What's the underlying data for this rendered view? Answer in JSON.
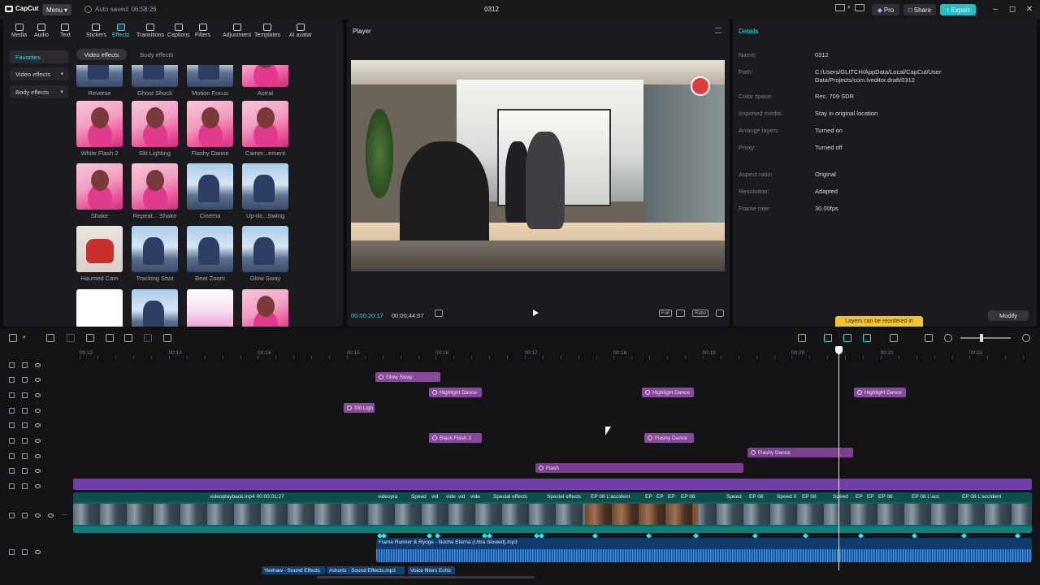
{
  "app": {
    "brand": "CapCut",
    "menu_label": "Menu",
    "autosave": "Auto saved: 06:58:26",
    "project_title": "0312",
    "pro_label": "Pro",
    "share_label": "Share",
    "export_label": "Export",
    "accent_color": "#1fc0c7"
  },
  "toolbar": [
    {
      "label": "Media",
      "icon": "media-icon"
    },
    {
      "label": "Audio",
      "icon": "audio-icon"
    },
    {
      "label": "Text",
      "icon": "text-icon"
    },
    {
      "label": "Stickers",
      "icon": "stickers-icon"
    },
    {
      "label": "Effects",
      "icon": "effects-icon",
      "active": true
    },
    {
      "label": "Transitions",
      "icon": "transitions-icon"
    },
    {
      "label": "Captions",
      "icon": "captions-icon"
    },
    {
      "label": "Filters",
      "icon": "filters-icon"
    },
    {
      "label": "Adjustment",
      "icon": "adjustment-icon"
    },
    {
      "label": "Templates",
      "icon": "templates-icon"
    },
    {
      "label": "AI avatar",
      "icon": "ai-avatar-icon"
    }
  ],
  "sidebar": {
    "favorites": "Favorites",
    "video_effects": "Video effects",
    "body_effects": "Body effects"
  },
  "subtabs": {
    "video_effects": "Video effects",
    "body_effects": "Body effects"
  },
  "effects": [
    {
      "label": "Reverse",
      "style": "sky"
    },
    {
      "label": "Ghost Shock",
      "style": "sky"
    },
    {
      "label": "Motion Focus",
      "style": "sky"
    },
    {
      "label": "Astral",
      "style": "pink"
    },
    {
      "label": "White Flash 2",
      "style": "pink"
    },
    {
      "label": "Slit Lighting",
      "style": "pink"
    },
    {
      "label": "Flashy Dance",
      "style": "pink"
    },
    {
      "label": "Camer...ement",
      "style": "pink"
    },
    {
      "label": "Shake",
      "style": "pink"
    },
    {
      "label": "Repeat... Shake",
      "style": "pink"
    },
    {
      "label": "Cinema",
      "style": "sky"
    },
    {
      "label": "Up-do...Swing",
      "style": "sky"
    },
    {
      "label": "Haunted Cam",
      "style": "red"
    },
    {
      "label": "Tracking Shot",
      "style": "sky"
    },
    {
      "label": "Beat Zoom",
      "style": "sky"
    },
    {
      "label": "Glow Sway",
      "style": "sky"
    },
    {
      "label": "",
      "style": "white"
    },
    {
      "label": "",
      "style": "sky"
    },
    {
      "label": "",
      "style": "dancer"
    },
    {
      "label": "",
      "style": "pink"
    }
  ],
  "player": {
    "title": "Player",
    "current_time": "00:00:20:17",
    "total_time": "00:00:44:07",
    "full_label": "Full",
    "ratio_label": "Ratio"
  },
  "details": {
    "title": "Details",
    "rows": [
      {
        "k": "Name:",
        "v": "0312"
      },
      {
        "k": "Path:",
        "v": "C:/Users/GLITCH/AppData/Local/CapCut/User Data/Projects/com.lveditor.draft/0312"
      },
      {
        "k": "Color space:",
        "v": "Rec. 709 SDR"
      },
      {
        "k": "Imported media:",
        "v": "Stay in original location"
      },
      {
        "k": "Arrange layers",
        "v": "Turned on"
      },
      {
        "k": "Proxy:",
        "v": "Turned off"
      },
      {
        "k": "Aspect ratio:",
        "v": "Original"
      },
      {
        "k": "Resolution:",
        "v": "Adapted"
      },
      {
        "k": "Frame rate:",
        "v": "30.00fps"
      }
    ],
    "modify_label": "Modify",
    "tooltip": "Layers can be reordered in"
  },
  "timeline": {
    "ruler": [
      "00:12",
      "00:13",
      "00:14",
      "00:15",
      "00:16",
      "00:17",
      "00:18",
      "00:19",
      "00:20",
      "00:21",
      "00:22"
    ],
    "effect_clips": [
      {
        "label": "Glow Sway"
      },
      {
        "label": "Highlight Dance"
      },
      {
        "label": "Highlight Dance"
      },
      {
        "label": "Highlight Dance"
      },
      {
        "label": "Slit Ligh"
      },
      {
        "label": "Black Flash 2"
      },
      {
        "label": "Flashy Dance"
      },
      {
        "label": "Flashy Dance"
      },
      {
        "label": "Flash"
      }
    ],
    "main_clip_labels": [
      "videoplayback.mp4 00:00:01:27",
      "videopla",
      "Speed",
      "vid",
      "vide",
      "vid",
      "vide",
      "Special effects",
      "Special effects",
      "EP 08 L'accident",
      "EP",
      "EP",
      "EP",
      "EP 08",
      "Speed",
      "EP 08",
      "Speed 0",
      "EP 08",
      "Speed",
      "EP",
      "EP",
      "EP 08",
      "EP 08 L'acc",
      "EP 08 L'accident"
    ],
    "audio_label": "Flame Runner & Ryoge - Noche Eterna (Ultra Slowed).mp3",
    "sfx_clips": [
      "Yeehaw - Sound Effects",
      "#shorts - Sound Effects.mp3",
      "Voice filters Echo"
    ]
  }
}
